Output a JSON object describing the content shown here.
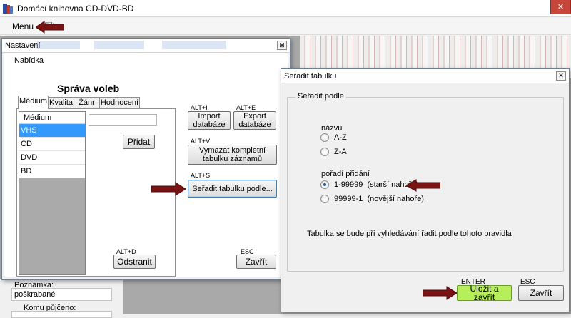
{
  "app": {
    "title": "Domácí knihovna CD-DVD-BD",
    "close_glyph": "✕",
    "menu_label": "Menu",
    "menu_faded_label": "Filtr"
  },
  "settings_window": {
    "title": "Nastavení",
    "close_glyph": "⊠",
    "nabidka_label": "Nabídka",
    "section_title": "Správa voleb",
    "tabs": [
      {
        "label": "Médium",
        "active": true
      },
      {
        "label": "Kvalita",
        "active": false
      },
      {
        "label": "Žánr",
        "active": false
      },
      {
        "label": "Hodnocení",
        "active": false
      }
    ],
    "list_header": "Médium",
    "list_items": [
      {
        "label": "VHS",
        "selected": true
      },
      {
        "label": "CD",
        "selected": false
      },
      {
        "label": "DVD",
        "selected": false
      },
      {
        "label": "BD",
        "selected": false
      }
    ],
    "add_button": "Přidat",
    "remove_hint": "ALT+D",
    "remove_button": "Odstranit",
    "import_hint": "ALT+I",
    "import_button": "Import databáze",
    "export_hint": "ALT+E",
    "export_button": "Export databáze",
    "clear_hint": "ALT+V",
    "clear_button": "Vymazat kompletní tabulku záznamů",
    "sort_hint": "ALT+S",
    "sort_button": "Seřadit tabulku podle...",
    "close_hint": "ESC",
    "close_button": "Zavřít"
  },
  "bottom_panel": {
    "note_label": "Poznámka:",
    "note_value": "poškrabané",
    "lent_label": "Komu půjčeno:"
  },
  "sort_window": {
    "title": "Seřadit tabulku",
    "close_glyph": "✕",
    "group_label": "Seřadit podle",
    "name_label": "názvu",
    "name_options": [
      {
        "label": "A-Z",
        "checked": false
      },
      {
        "label": "Z-A",
        "checked": false
      }
    ],
    "order_label": "pořadí přidání",
    "order_options": [
      {
        "label": "1-99999  (starší nahoře)",
        "checked": true
      },
      {
        "label": "99999-1  (novější nahoře)",
        "checked": false
      }
    ],
    "info_text": "Tabulka se bude při vyhledávání řadit podle tohoto pravidla",
    "save_hint": "ENTER",
    "save_button": "Uložit a zavřít",
    "close_hint": "ESC",
    "close_button": "Zavřít"
  },
  "colors": {
    "save_button": "#b7ef5a",
    "arrow": "#7a1414",
    "selection": "#3399ff"
  }
}
